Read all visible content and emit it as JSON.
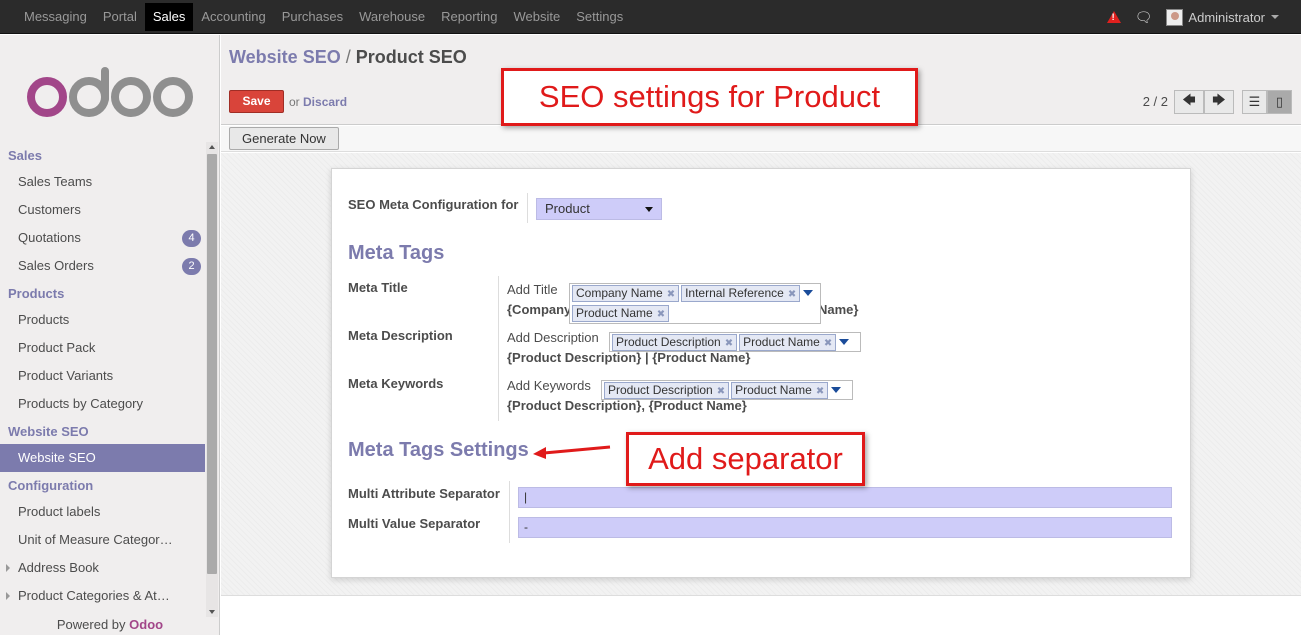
{
  "topbar": {
    "menu": [
      "Messaging",
      "Portal",
      "Sales",
      "Accounting",
      "Purchases",
      "Warehouse",
      "Reporting",
      "Website",
      "Settings"
    ],
    "active": "Sales",
    "user": "Administrator"
  },
  "sidebar": {
    "logo_text": "odoo",
    "sections": [
      {
        "head": "Sales",
        "items": [
          {
            "label": "Sales Teams"
          },
          {
            "label": "Customers"
          },
          {
            "label": "Quotations",
            "badge": "4"
          },
          {
            "label": "Sales Orders",
            "badge": "2"
          }
        ]
      },
      {
        "head": "Products",
        "items": [
          {
            "label": "Products"
          },
          {
            "label": "Product Pack"
          },
          {
            "label": "Product Variants"
          },
          {
            "label": "Products by Category"
          }
        ]
      },
      {
        "head": "Website SEO",
        "items": [
          {
            "label": "Website SEO",
            "active": true
          }
        ]
      },
      {
        "head": "Configuration",
        "items": [
          {
            "label": "Product labels"
          },
          {
            "label": "Unit of Measure Categor…"
          },
          {
            "label": "Address Book",
            "expandable": true
          },
          {
            "label": "Product Categories & At…",
            "expandable": true
          }
        ]
      }
    ],
    "powered_prefix": "Powered by ",
    "powered_brand": "Odoo"
  },
  "control": {
    "breadcrumb_parent": "Website SEO",
    "breadcrumb_sep": "/",
    "breadcrumb_current": "Product SEO",
    "save_label": "Save",
    "or_label": "or",
    "discard_label": "Discard",
    "pager": "2 / 2"
  },
  "statusbar": {
    "generate_label": "Generate Now"
  },
  "form": {
    "config_label": "SEO Meta Configuration for",
    "config_value": "Product",
    "meta_tags_heading": "Meta Tags",
    "meta_title_label": "Meta Title",
    "meta_title_add": "Add Title",
    "meta_title_tags": [
      "Company Name",
      "Internal Reference",
      "Product Name"
    ],
    "meta_title_expr_left": "{Company",
    "meta_title_expr_right": "Name}",
    "meta_desc_label": "Meta Description",
    "meta_desc_add": "Add Description",
    "meta_desc_tags": [
      "Product Description",
      "Product Name"
    ],
    "meta_desc_expr": "{Product Description} | {Product Name}",
    "meta_kw_label": "Meta Keywords",
    "meta_kw_add": "Add Keywords",
    "meta_kw_tags": [
      "Product Description",
      "Product Name"
    ],
    "meta_kw_expr": "{Product Description}, {Product Name}",
    "settings_heading": "Meta Tags Settings",
    "multi_attr_label": "Multi Attribute Separator",
    "multi_attr_value": "|",
    "multi_val_label": "Multi Value Separator",
    "multi_val_value": "-"
  },
  "annotations": {
    "seo_callout": "SEO settings for Product",
    "separator_callout": "Add separator"
  },
  "colors": {
    "accent": "#7c7bad",
    "save": "#d9443a",
    "callout": "#e01a1a",
    "field_bg": "#ceccf9",
    "brand": "#a24689"
  }
}
